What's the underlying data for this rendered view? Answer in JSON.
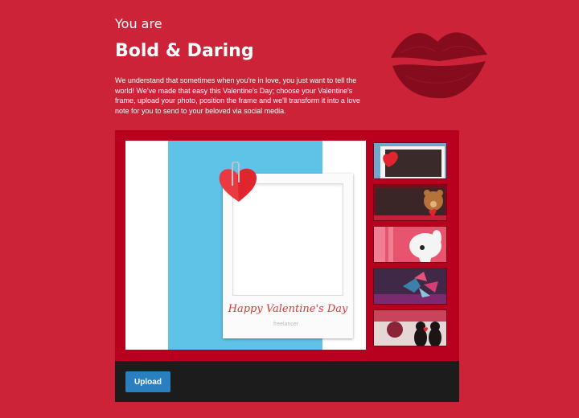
{
  "intro": {
    "kicker": "You are",
    "title": "Bold & Daring",
    "description": "We understand that sometimes when you're in love, you just want to tell the world! We've made that easy this Valentine's Day; choose your Valentine's frame, upload your photo, position the frame and we'll transform it into a love note for you to send to your beloved via social media."
  },
  "frame": {
    "caption": "Happy Valentine's Day",
    "brand": "freelancer"
  },
  "thumbnails": [
    {
      "name": "heart-polaroid-frame"
    },
    {
      "name": "teddy-bear-frame"
    },
    {
      "name": "cartoon-dog-frame"
    },
    {
      "name": "origami-bird-frame"
    },
    {
      "name": "cat-couple-frame"
    }
  ],
  "toolbar": {
    "upload_label": "Upload"
  },
  "colors": {
    "page_background": "#cc2338",
    "editor_border": "#b8001f",
    "toolbar": "#1c1c1c",
    "upload_button": "#2a7fc1",
    "frame_background": "#5ec3e6"
  }
}
